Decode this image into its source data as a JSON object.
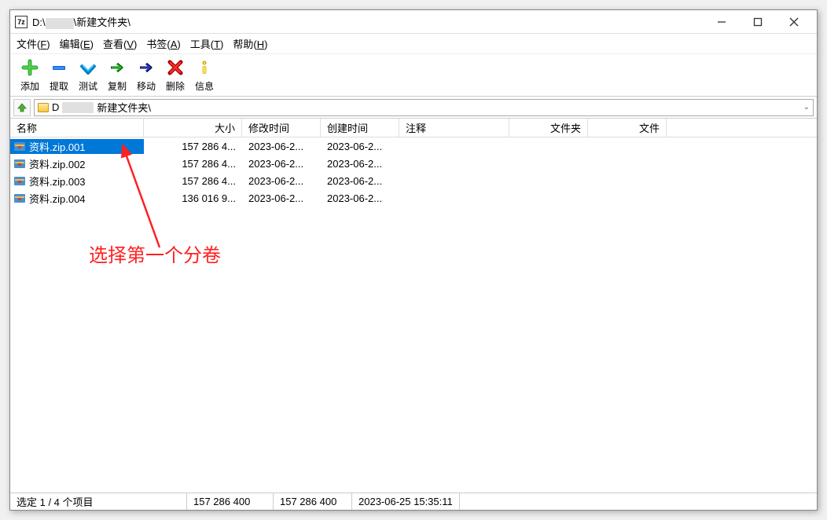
{
  "title": {
    "prefix": "D:\\",
    "suffix": "\\新建文件夹\\"
  },
  "menu": {
    "file": "文件(F)",
    "edit": "编辑(E)",
    "view": "查看(V)",
    "bookmark": "书签(A)",
    "tools": "工具(T)",
    "help": "帮助(H)"
  },
  "toolbar": {
    "add": "添加",
    "extract": "提取",
    "test": "测试",
    "copy": "复制",
    "move": "移动",
    "delete": "删除",
    "info": "信息"
  },
  "address": {
    "prefix": "D",
    "suffix": "新建文件夹\\"
  },
  "columns": {
    "name": "名称",
    "size": "大小",
    "modified": "修改时间",
    "created": "创建时间",
    "comment": "注释",
    "folder": "文件夹",
    "file": "文件"
  },
  "files": [
    {
      "name": "资料.zip.001",
      "size": "157 286 4...",
      "modified": "2023-06-2...",
      "created": "2023-06-2...",
      "selected": true
    },
    {
      "name": "资料.zip.002",
      "size": "157 286 4...",
      "modified": "2023-06-2...",
      "created": "2023-06-2...",
      "selected": false
    },
    {
      "name": "资料.zip.003",
      "size": "157 286 4...",
      "modified": "2023-06-2...",
      "created": "2023-06-2...",
      "selected": false
    },
    {
      "name": "资料.zip.004",
      "size": "136 016 9...",
      "modified": "2023-06-2...",
      "created": "2023-06-2...",
      "selected": false
    }
  ],
  "annotation": "选择第一个分卷",
  "status": {
    "selection": "选定 1 / 4 个项目",
    "size1": "157 286 400",
    "size2": "157 286 400",
    "datetime": "2023-06-25 15:35:11"
  }
}
